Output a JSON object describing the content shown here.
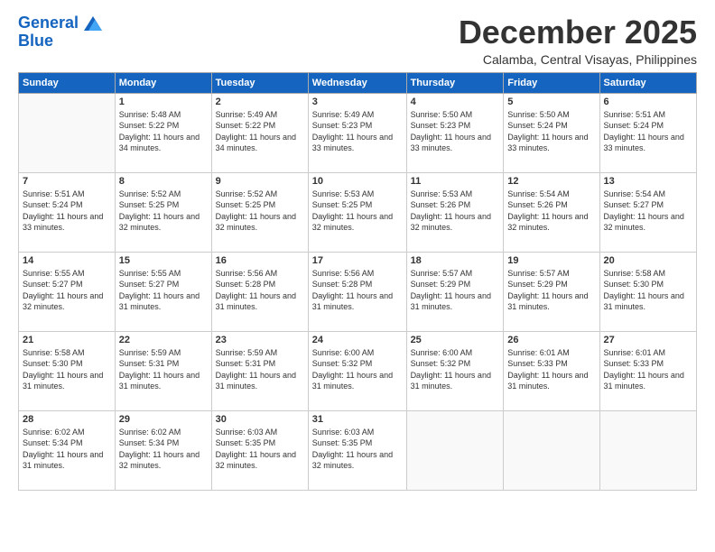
{
  "logo": {
    "line1": "General",
    "line2": "Blue"
  },
  "title": "December 2025",
  "location": "Calamba, Central Visayas, Philippines",
  "days_of_week": [
    "Sunday",
    "Monday",
    "Tuesday",
    "Wednesday",
    "Thursday",
    "Friday",
    "Saturday"
  ],
  "weeks": [
    [
      {
        "day": "",
        "sunrise": "",
        "sunset": "",
        "daylight": ""
      },
      {
        "day": "1",
        "sunrise": "5:48 AM",
        "sunset": "5:22 PM",
        "daylight": "11 hours and 34 minutes."
      },
      {
        "day": "2",
        "sunrise": "5:49 AM",
        "sunset": "5:22 PM",
        "daylight": "11 hours and 34 minutes."
      },
      {
        "day": "3",
        "sunrise": "5:49 AM",
        "sunset": "5:23 PM",
        "daylight": "11 hours and 33 minutes."
      },
      {
        "day": "4",
        "sunrise": "5:50 AM",
        "sunset": "5:23 PM",
        "daylight": "11 hours and 33 minutes."
      },
      {
        "day": "5",
        "sunrise": "5:50 AM",
        "sunset": "5:24 PM",
        "daylight": "11 hours and 33 minutes."
      },
      {
        "day": "6",
        "sunrise": "5:51 AM",
        "sunset": "5:24 PM",
        "daylight": "11 hours and 33 minutes."
      }
    ],
    [
      {
        "day": "7",
        "sunrise": "5:51 AM",
        "sunset": "5:24 PM",
        "daylight": "11 hours and 33 minutes."
      },
      {
        "day": "8",
        "sunrise": "5:52 AM",
        "sunset": "5:25 PM",
        "daylight": "11 hours and 32 minutes."
      },
      {
        "day": "9",
        "sunrise": "5:52 AM",
        "sunset": "5:25 PM",
        "daylight": "11 hours and 32 minutes."
      },
      {
        "day": "10",
        "sunrise": "5:53 AM",
        "sunset": "5:25 PM",
        "daylight": "11 hours and 32 minutes."
      },
      {
        "day": "11",
        "sunrise": "5:53 AM",
        "sunset": "5:26 PM",
        "daylight": "11 hours and 32 minutes."
      },
      {
        "day": "12",
        "sunrise": "5:54 AM",
        "sunset": "5:26 PM",
        "daylight": "11 hours and 32 minutes."
      },
      {
        "day": "13",
        "sunrise": "5:54 AM",
        "sunset": "5:27 PM",
        "daylight": "11 hours and 32 minutes."
      }
    ],
    [
      {
        "day": "14",
        "sunrise": "5:55 AM",
        "sunset": "5:27 PM",
        "daylight": "11 hours and 32 minutes."
      },
      {
        "day": "15",
        "sunrise": "5:55 AM",
        "sunset": "5:27 PM",
        "daylight": "11 hours and 31 minutes."
      },
      {
        "day": "16",
        "sunrise": "5:56 AM",
        "sunset": "5:28 PM",
        "daylight": "11 hours and 31 minutes."
      },
      {
        "day": "17",
        "sunrise": "5:56 AM",
        "sunset": "5:28 PM",
        "daylight": "11 hours and 31 minutes."
      },
      {
        "day": "18",
        "sunrise": "5:57 AM",
        "sunset": "5:29 PM",
        "daylight": "11 hours and 31 minutes."
      },
      {
        "day": "19",
        "sunrise": "5:57 AM",
        "sunset": "5:29 PM",
        "daylight": "11 hours and 31 minutes."
      },
      {
        "day": "20",
        "sunrise": "5:58 AM",
        "sunset": "5:30 PM",
        "daylight": "11 hours and 31 minutes."
      }
    ],
    [
      {
        "day": "21",
        "sunrise": "5:58 AM",
        "sunset": "5:30 PM",
        "daylight": "11 hours and 31 minutes."
      },
      {
        "day": "22",
        "sunrise": "5:59 AM",
        "sunset": "5:31 PM",
        "daylight": "11 hours and 31 minutes."
      },
      {
        "day": "23",
        "sunrise": "5:59 AM",
        "sunset": "5:31 PM",
        "daylight": "11 hours and 31 minutes."
      },
      {
        "day": "24",
        "sunrise": "6:00 AM",
        "sunset": "5:32 PM",
        "daylight": "11 hours and 31 minutes."
      },
      {
        "day": "25",
        "sunrise": "6:00 AM",
        "sunset": "5:32 PM",
        "daylight": "11 hours and 31 minutes."
      },
      {
        "day": "26",
        "sunrise": "6:01 AM",
        "sunset": "5:33 PM",
        "daylight": "11 hours and 31 minutes."
      },
      {
        "day": "27",
        "sunrise": "6:01 AM",
        "sunset": "5:33 PM",
        "daylight": "11 hours and 31 minutes."
      }
    ],
    [
      {
        "day": "28",
        "sunrise": "6:02 AM",
        "sunset": "5:34 PM",
        "daylight": "11 hours and 31 minutes."
      },
      {
        "day": "29",
        "sunrise": "6:02 AM",
        "sunset": "5:34 PM",
        "daylight": "11 hours and 32 minutes."
      },
      {
        "day": "30",
        "sunrise": "6:03 AM",
        "sunset": "5:35 PM",
        "daylight": "11 hours and 32 minutes."
      },
      {
        "day": "31",
        "sunrise": "6:03 AM",
        "sunset": "5:35 PM",
        "daylight": "11 hours and 32 minutes."
      },
      {
        "day": "",
        "sunrise": "",
        "sunset": "",
        "daylight": ""
      },
      {
        "day": "",
        "sunrise": "",
        "sunset": "",
        "daylight": ""
      },
      {
        "day": "",
        "sunrise": "",
        "sunset": "",
        "daylight": ""
      }
    ]
  ],
  "labels": {
    "sunrise_prefix": "Sunrise: ",
    "sunset_prefix": "Sunset: ",
    "daylight_prefix": "Daylight: "
  }
}
